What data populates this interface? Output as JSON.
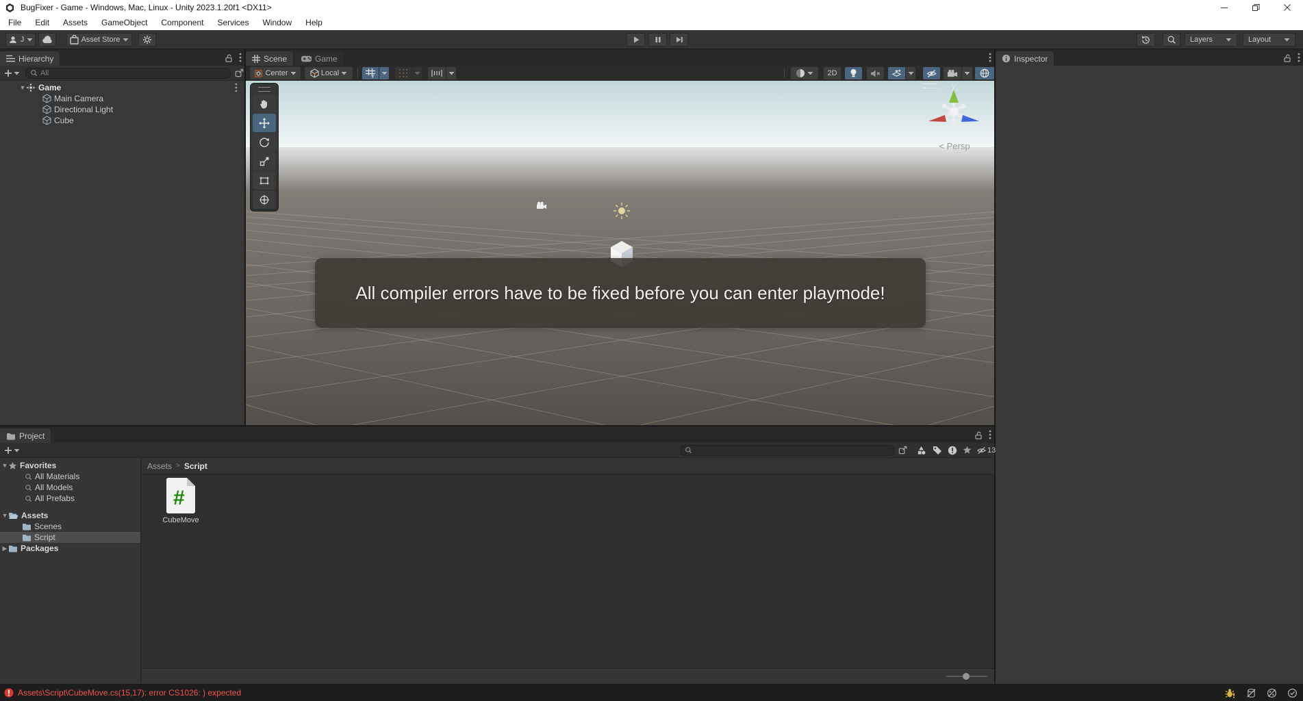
{
  "window": {
    "title": "BugFixer - Game - Windows, Mac, Linux - Unity 2023.1.20f1 <DX11>"
  },
  "menubar": {
    "items": [
      "File",
      "Edit",
      "Assets",
      "GameObject",
      "Component",
      "Services",
      "Window",
      "Help"
    ]
  },
  "toolbar": {
    "account_label": "J",
    "asset_store_label": "Asset Store",
    "layers_label": "Layers",
    "layout_label": "Layout"
  },
  "hierarchy": {
    "tab": "Hierarchy",
    "search_placeholder": "All",
    "scene": {
      "name": "Game",
      "items": [
        "Main Camera",
        "Directional Light",
        "Cube"
      ]
    }
  },
  "scene_view": {
    "tabs": [
      {
        "label": "Scene",
        "icon": "grid"
      },
      {
        "label": "Game",
        "icon": "gamepad"
      }
    ],
    "toolbar": {
      "pivot_label": "Center",
      "orientation_label": "Local",
      "mode_2d": "2D"
    },
    "tools": [
      {
        "name": "hand"
      },
      {
        "name": "move",
        "selected": true
      },
      {
        "name": "rotate"
      },
      {
        "name": "scale"
      },
      {
        "name": "rect"
      },
      {
        "name": "transform"
      }
    ],
    "gizmo": {
      "x": "x",
      "y": "y",
      "z": "z",
      "persp_label": "Persp"
    },
    "notification": "All compiler errors have to be fixed before you can enter playmode!"
  },
  "inspector": {
    "tab": "Inspector"
  },
  "project": {
    "tab": "Project",
    "breadcrumb": {
      "root": "Assets",
      "separator": ">",
      "current": "Script"
    },
    "tree": {
      "favorites": {
        "label": "Favorites",
        "items": [
          "All Materials",
          "All Models",
          "All Prefabs"
        ]
      },
      "assets": {
        "label": "Assets",
        "children": [
          "Scenes",
          "Script"
        ],
        "selected": "Script"
      },
      "packages_label": "Packages"
    },
    "asset_item": {
      "name": "CubeMove"
    },
    "hidden_count": "13"
  },
  "statusbar": {
    "error_text": "Assets\\Script\\CubeMove.cs(15,17): error CS1026: ) expected"
  },
  "colors": {
    "accent_blue": "#4a657f",
    "error_red": "#f2564a",
    "script_green": "#178600"
  }
}
